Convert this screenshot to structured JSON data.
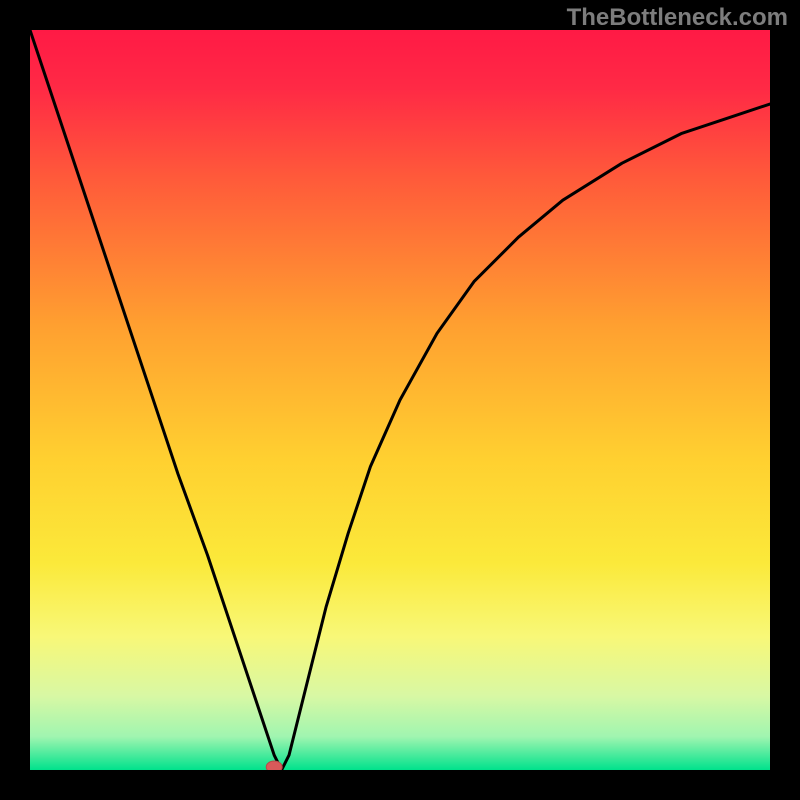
{
  "attribution": "TheBottleneck.com",
  "colors": {
    "frame": "#000000",
    "attribution_text": "#7d7d7d",
    "gradient_stops": [
      {
        "offset": 0.0,
        "color": "#ff1a45"
      },
      {
        "offset": 0.08,
        "color": "#ff2a45"
      },
      {
        "offset": 0.2,
        "color": "#ff5a3a"
      },
      {
        "offset": 0.4,
        "color": "#ffa030"
      },
      {
        "offset": 0.58,
        "color": "#ffd030"
      },
      {
        "offset": 0.72,
        "color": "#fbe93a"
      },
      {
        "offset": 0.82,
        "color": "#f8f878"
      },
      {
        "offset": 0.9,
        "color": "#d8f8a4"
      },
      {
        "offset": 0.955,
        "color": "#a0f5b0"
      },
      {
        "offset": 1.0,
        "color": "#00e28c"
      }
    ],
    "curve": "#000000",
    "marker_fill": "#d85a5a",
    "marker_stroke": "#b84848"
  },
  "chart_data": {
    "type": "line",
    "title": "",
    "xlabel": "",
    "ylabel": "",
    "xlim": [
      0,
      100
    ],
    "ylim": [
      0,
      100
    ],
    "series": [
      {
        "name": "bottleneck-curve",
        "x": [
          0,
          2,
          5,
          8,
          12,
          16,
          20,
          24,
          28,
          30,
          32,
          33,
          34,
          35,
          36,
          38,
          40,
          43,
          46,
          50,
          55,
          60,
          66,
          72,
          80,
          88,
          94,
          100
        ],
        "y": [
          100,
          94,
          85,
          76,
          64,
          52,
          40,
          29,
          17,
          11,
          5,
          2,
          0,
          2,
          6,
          14,
          22,
          32,
          41,
          50,
          59,
          66,
          72,
          77,
          82,
          86,
          88,
          90
        ]
      }
    ],
    "marker": {
      "x": 33,
      "y": 0
    },
    "annotations": []
  }
}
